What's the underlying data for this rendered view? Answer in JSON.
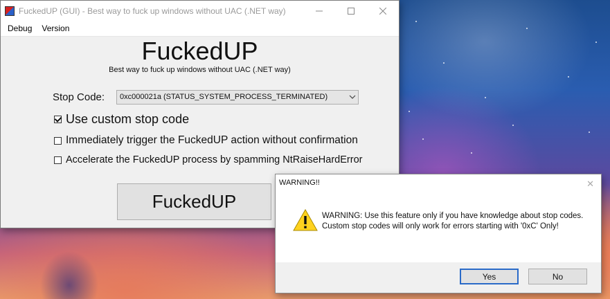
{
  "main_window": {
    "title": "FuckedUP (GUI) - Best way to fuck up windows without UAC (.NET way)",
    "controls": {
      "minimize": "minimize-icon",
      "maximize": "maximize-icon",
      "close": "close-icon"
    },
    "menu": [
      {
        "label": "Debug"
      },
      {
        "label": "Version"
      }
    ],
    "heading": "FuckedUP",
    "subheading": "Best way to fuck up windows without UAC (.NET way)",
    "stop_code": {
      "label": "Stop Code:",
      "selected": "0xc000021a (STATUS_SYSTEM_PROCESS_TERMINATED)"
    },
    "checkboxes": [
      {
        "label": "Use custom stop code",
        "checked": true
      },
      {
        "label": "Immediately trigger the FuckedUP action without confirmation",
        "checked": false
      },
      {
        "label": "Accelerate the FuckedUP process by spamming NtRaiseHardError",
        "checked": false
      }
    ],
    "action_button": "FuckedUP"
  },
  "dialog": {
    "title": "WARNING!!",
    "icon": "warning-icon",
    "message": "WARNING: Use this feature only if you have knowledge about stop codes. Custom stop codes will only work for errors starting with '0xC' Only!",
    "buttons": {
      "yes": "Yes",
      "no": "No"
    },
    "close_glyph": "✕"
  },
  "colors": {
    "warning_yellow": "#ffd21f",
    "default_button_border": "#2a6ac8"
  }
}
